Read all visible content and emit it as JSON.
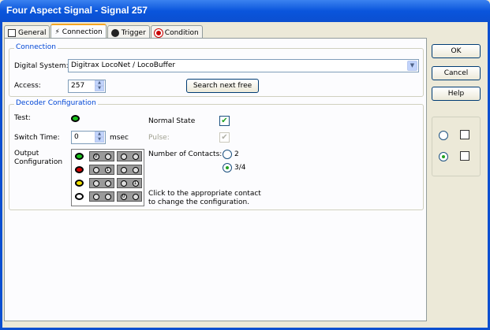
{
  "window": {
    "title": "Four Aspect Signal - Signal 257"
  },
  "tabs": [
    {
      "label": "General"
    },
    {
      "label": "Connection"
    },
    {
      "label": "Trigger"
    },
    {
      "label": "Condition"
    }
  ],
  "connection": {
    "group_label": "Connection",
    "digital_system_label": "Digital System:",
    "digital_system_value": "Digitrax LocoNet / LocoBuffer",
    "access_label": "Access:",
    "access_value": "257",
    "search_button": "Search next free"
  },
  "decoder": {
    "group_label": "Decoder Configuration",
    "test_label": "Test:",
    "normal_state_label": "Normal State",
    "switch_time_label": "Switch Time:",
    "switch_time_value": "0",
    "switch_time_unit": "msec",
    "pulse_label": "Pulse:",
    "output_config_label": "Output Configuration",
    "number_contacts_label": "Number of Contacts:",
    "contacts_option_2": "2",
    "contacts_option_34": "3/4",
    "hint": "Click to the appropriate contact to change the configuration.",
    "led_colors": [
      "#19c11a",
      "#d20000",
      "#f0e000",
      "#ffffff"
    ]
  },
  "buttons": {
    "ok": "OK",
    "cancel": "Cancel",
    "help": "Help"
  }
}
